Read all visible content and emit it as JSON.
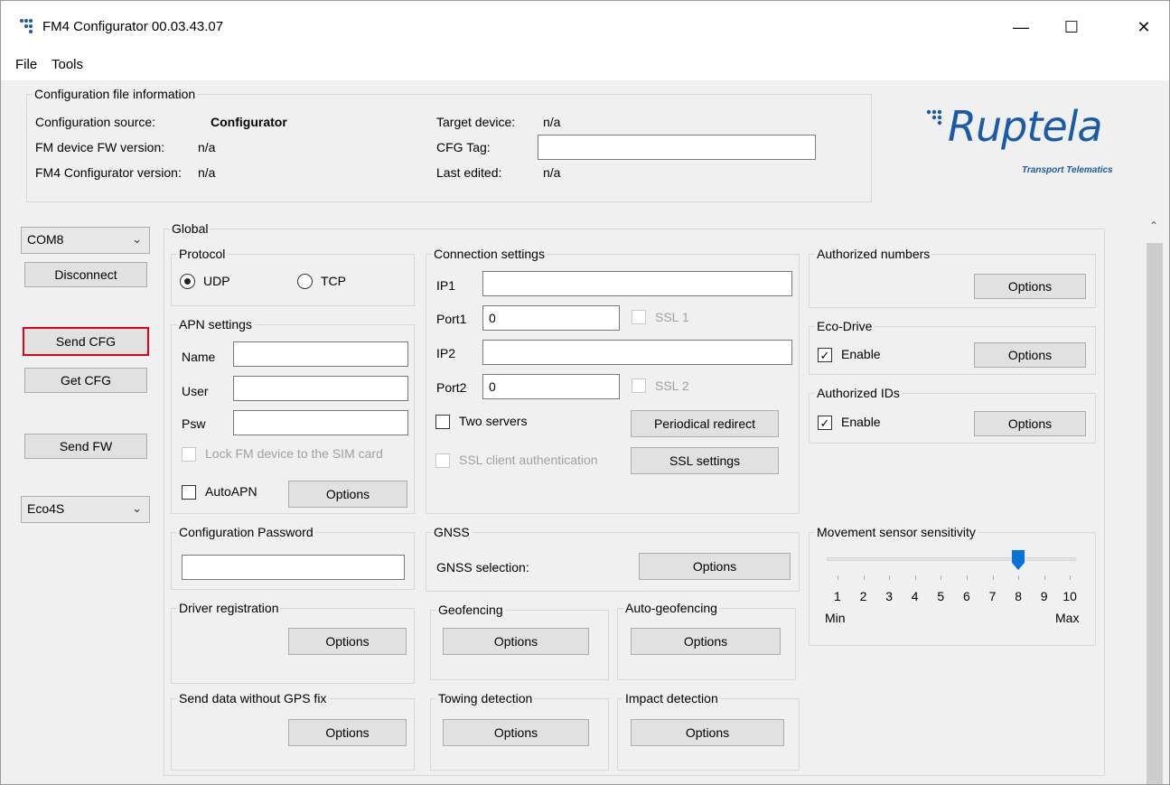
{
  "window": {
    "title": "FM4 Configurator 00.03.43.07",
    "minimize": "—",
    "maximize": "☐",
    "close": "✕"
  },
  "menu": {
    "file": "File",
    "tools": "Tools"
  },
  "file_info": {
    "legend": "Configuration file information",
    "source_label": "Configuration source:",
    "source_value": "Configurator",
    "fw_label": "FM device FW version:",
    "fw_value": "n/a",
    "cfgver_label": "FM4 Configurator version:",
    "cfgver_value": "n/a",
    "target_label": "Target device:",
    "target_value": "n/a",
    "tag_label": "CFG Tag:",
    "tag_value": "",
    "edited_label": "Last edited:",
    "edited_value": "n/a"
  },
  "logo": {
    "text": "Ruptela",
    "sub": "Transport Telematics",
    "color": "#1a5aa8"
  },
  "left": {
    "port": "COM8",
    "disconnect": "Disconnect",
    "send_cfg": "Send CFG",
    "get_cfg": "Get CFG",
    "send_fw": "Send FW",
    "device": "Eco4S"
  },
  "global": {
    "legend": "Global",
    "protocol": {
      "legend": "Protocol",
      "udp": "UDP",
      "tcp": "TCP",
      "selected": "UDP"
    },
    "apn": {
      "legend": "APN settings",
      "name_label": "Name",
      "user_label": "User",
      "psw_label": "Psw",
      "name": "",
      "user": "",
      "psw": "",
      "lock_label": "Lock FM device to the SIM card",
      "autoapn_label": "AutoAPN",
      "options": "Options"
    },
    "connection": {
      "legend": "Connection settings",
      "ip1_label": "IP1",
      "ip1": "",
      "port1_label": "Port1",
      "port1": "0",
      "ssl1": "SSL 1",
      "ip2_label": "IP2",
      "ip2": "",
      "port2_label": "Port2",
      "port2": "0",
      "ssl2": "SSL 2",
      "two_servers": "Two servers",
      "periodical": "Periodical redirect",
      "ssl_client": "SSL client authentication",
      "ssl_settings": "SSL settings"
    },
    "authorized_numbers": {
      "legend": "Authorized numbers",
      "options": "Options"
    },
    "eco_drive": {
      "legend": "Eco-Drive",
      "enable": "Enable",
      "checked": true,
      "options": "Options"
    },
    "authorized_ids": {
      "legend": "Authorized IDs",
      "enable": "Enable",
      "checked": true,
      "options": "Options"
    },
    "config_password": {
      "legend": "Configuration Password",
      "value": ""
    },
    "gnss": {
      "legend": "GNSS",
      "label": "GNSS selection:",
      "options": "Options"
    },
    "movement": {
      "legend": "Movement sensor sensitivity",
      "value": 8,
      "ticks": [
        "1",
        "2",
        "3",
        "4",
        "5",
        "6",
        "7",
        "8",
        "9",
        "10"
      ],
      "min": "Min",
      "max": "Max"
    },
    "driver_registration": {
      "legend": "Driver registration",
      "options": "Options"
    },
    "geofencing": {
      "legend": "Geofencing",
      "options": "Options"
    },
    "auto_geofencing": {
      "legend": "Auto-geofencing",
      "options": "Options"
    },
    "send_data": {
      "legend": "Send data without GPS fix",
      "options": "Options"
    },
    "towing": {
      "legend": "Towing detection",
      "options": "Options"
    },
    "impact": {
      "legend": "Impact detection",
      "options": "Options"
    }
  }
}
